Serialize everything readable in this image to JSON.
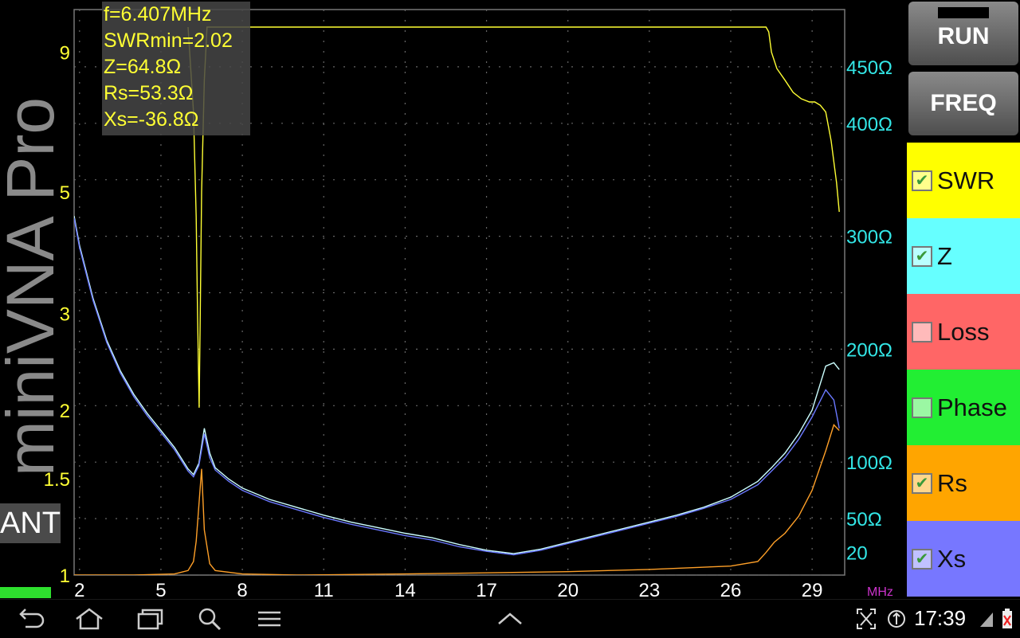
{
  "app": {
    "brand": "miniVNA Pro",
    "ant_label": "ANT"
  },
  "readout": {
    "freq": "f=6.407MHz",
    "swr_min": "SWRmin=2.02",
    "z": "Z=64.8Ω",
    "rs": "Rs=53.3Ω",
    "xs": "Xs=-36.8Ω"
  },
  "buttons": {
    "run": "RUN",
    "freq": "FREQ"
  },
  "traces": [
    {
      "key": "swr",
      "label": "SWR",
      "checked": true,
      "color": "#ffff00"
    },
    {
      "key": "z",
      "label": "Z",
      "checked": true,
      "color": "#66ffff"
    },
    {
      "key": "loss",
      "label": "Loss",
      "checked": false,
      "color": "#ff6666"
    },
    {
      "key": "phase",
      "label": "Phase",
      "checked": false,
      "color": "#22ee33"
    },
    {
      "key": "rs",
      "label": "Rs",
      "checked": true,
      "color": "#ffa500"
    },
    {
      "key": "xs",
      "label": "Xs",
      "checked": true,
      "color": "#7777ff"
    }
  ],
  "statusbar": {
    "time": "17:39"
  },
  "chart_data": {
    "type": "line",
    "x_unit": "MHz",
    "x_ticks": [
      "2",
      "5",
      "8",
      "11",
      "14",
      "17",
      "20",
      "23",
      "26",
      "29"
    ],
    "xlim": [
      1.8,
      30.2
    ],
    "y_left_ticks": [
      "9",
      "5",
      "3",
      "2",
      "1.5",
      "1"
    ],
    "y_right_ticks": [
      "450Ω",
      "400Ω",
      "300Ω",
      "200Ω",
      "100Ω",
      "50Ω",
      "20"
    ],
    "grid": true,
    "series": [
      {
        "name": "SWR",
        "color": "#ffff33",
        "axis": "swr",
        "x": [
          6.0,
          6.2,
          6.3,
          6.35,
          6.407,
          6.45,
          6.5,
          6.6,
          6.7,
          27.3,
          27.4,
          27.5,
          27.7,
          28.0,
          28.3,
          28.6,
          28.9,
          29.1,
          29.3,
          29.5,
          29.7,
          29.9,
          30.0
        ],
        "y": [
          10,
          7.0,
          4.5,
          3.0,
          2.02,
          3.0,
          5.0,
          8.0,
          10,
          10,
          9.8,
          9.0,
          8.4,
          8.0,
          7.6,
          7.4,
          7.3,
          7.3,
          7.2,
          7.0,
          6.2,
          5.2,
          4.6
        ]
      },
      {
        "name": "Z",
        "color": "#ccffff",
        "axis": "ohm",
        "x": [
          1.8,
          2.0,
          2.5,
          3.0,
          3.5,
          4.0,
          4.5,
          5.0,
          5.5,
          6.0,
          6.2,
          6.4,
          6.6,
          6.8,
          7.0,
          7.5,
          8.0,
          9.0,
          10,
          11,
          12,
          13,
          14,
          15,
          16,
          17,
          18,
          19,
          20,
          21,
          22,
          23,
          24,
          25,
          26,
          27,
          27.5,
          28,
          28.5,
          29,
          29.5,
          29.8,
          30.0
        ],
        "y": [
          318,
          292,
          245,
          208,
          181,
          160,
          143,
          128,
          113,
          94,
          89,
          99,
          130,
          108,
          95,
          85,
          77,
          67,
          60,
          53,
          47,
          42,
          37,
          33,
          27,
          22,
          19,
          23,
          29,
          35,
          41,
          47,
          53,
          60,
          69,
          83,
          95,
          108,
          125,
          146,
          185,
          188,
          182
        ]
      },
      {
        "name": "Xs",
        "color": "#6a78ff",
        "axis": "ohm",
        "x": [
          1.8,
          2.0,
          2.5,
          3.0,
          3.5,
          4.0,
          4.5,
          5.0,
          5.5,
          6.0,
          6.2,
          6.4,
          6.6,
          6.8,
          7.0,
          7.5,
          8.0,
          9.0,
          10,
          11,
          12,
          13,
          14,
          15,
          16,
          17,
          18,
          19,
          20,
          21,
          22,
          23,
          24,
          25,
          26,
          27,
          27.5,
          28,
          28.5,
          29,
          29.5,
          29.8,
          30.0
        ],
        "y": [
          316,
          290,
          243,
          206,
          179,
          158,
          141,
          126,
          111,
          92,
          87,
          97,
          125,
          104,
          93,
          83,
          75,
          65,
          58,
          51,
          45,
          40,
          35,
          31,
          25,
          21,
          18,
          22,
          28,
          34,
          40,
          46,
          52,
          59,
          67,
          80,
          92,
          104,
          120,
          140,
          164,
          155,
          130
        ]
      },
      {
        "name": "Rs",
        "color": "#ffa028",
        "axis": "ohm",
        "x": [
          1.8,
          4.0,
          5.5,
          6.0,
          6.2,
          6.3,
          6.4,
          6.5,
          6.6,
          6.8,
          7.0,
          8.0,
          10,
          14,
          17,
          20,
          23,
          26,
          27,
          27.3,
          27.6,
          28.0,
          28.5,
          29.0,
          29.5,
          29.8,
          30.0
        ],
        "y": [
          0,
          0,
          1,
          4,
          12,
          30,
          62,
          94,
          40,
          10,
          4,
          1,
          0,
          1,
          2,
          3,
          5,
          8,
          12,
          20,
          29,
          37,
          52,
          75,
          110,
          133,
          128
        ]
      }
    ]
  }
}
